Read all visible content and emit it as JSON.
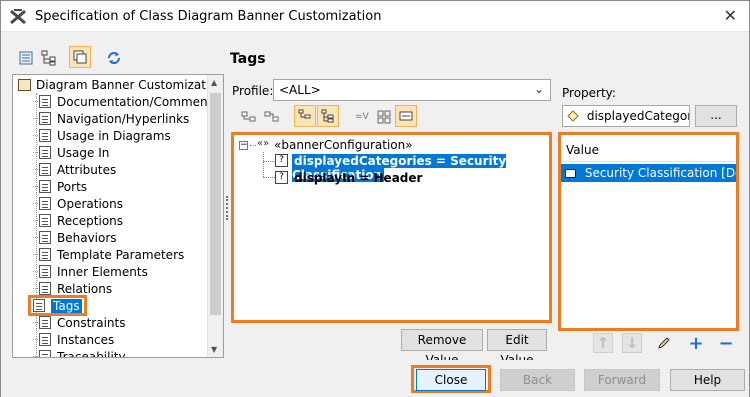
{
  "window": {
    "title": "Specification of Class Diagram Banner Customization",
    "close_glyph": "✕"
  },
  "toolbar": {
    "icons": [
      "list-view-icon",
      "tree-view-icon",
      "compact-view-icon",
      "refresh-icon"
    ],
    "active": "compact-view-icon"
  },
  "left_tree": {
    "root": "Diagram Banner Customization",
    "items": [
      "Documentation/Comments",
      "Navigation/Hyperlinks",
      "Usage in Diagrams",
      "Usage In",
      "Attributes",
      "Ports",
      "Operations",
      "Receptions",
      "Behaviors",
      "Template Parameters",
      "Inner Elements",
      "Relations",
      "Tags",
      "Constraints",
      "Instances",
      "Traceability"
    ],
    "selected": "Tags"
  },
  "tags_panel": {
    "title": "Tags",
    "profile_label": "Profile:",
    "profile_value": "<ALL>",
    "property_label": "Property:",
    "property_value": "displayedCategor...",
    "dots_label": "...",
    "tree": {
      "root_glyph": "«»",
      "root_label": "«bannerConfiguration»",
      "children": [
        {
          "label": "displayedCategories = Security Classification",
          "selected": true
        },
        {
          "label": "displayIn = Header",
          "selected": false
        }
      ]
    },
    "remove_value_label": "Remove Value",
    "edit_value_label": "Edit Value"
  },
  "value_panel": {
    "header": "Value",
    "rows": [
      "Security Classification [Do..."
    ]
  },
  "footer": {
    "close_label": "Close",
    "back_label": "Back",
    "forward_label": "Forward",
    "help_label": "Help"
  },
  "colors": {
    "highlight": "#ee7c22",
    "selection": "#0078d7"
  }
}
